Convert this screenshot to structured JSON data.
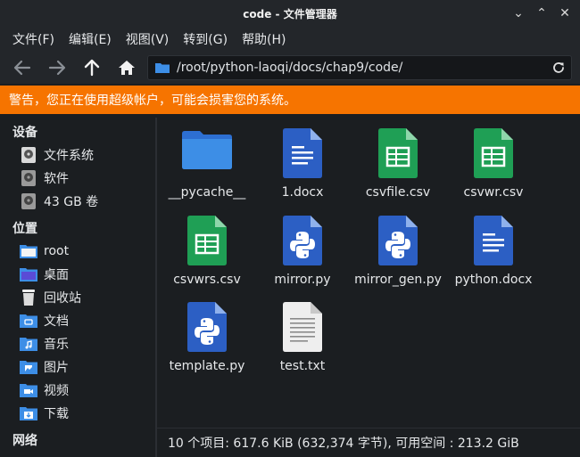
{
  "window": {
    "title": "code - 文件管理器"
  },
  "menu": [
    "文件(F)",
    "编辑(E)",
    "视图(V)",
    "转到(G)",
    "帮助(H)"
  ],
  "address": {
    "path": "/root/python-laoqi/docs/chap9/code/"
  },
  "warning": {
    "text": "警告，您正在使用超级帐户，可能会损害您的系统。",
    "color": "#f67400"
  },
  "sidebar": {
    "devices_title": "设备",
    "devices": [
      {
        "label": "文件系统",
        "icon": "drive-icon"
      },
      {
        "label": "软件",
        "icon": "drive-icon"
      },
      {
        "label": "43 GB 卷",
        "icon": "drive-icon"
      }
    ],
    "places_title": "位置",
    "places": [
      {
        "label": "root",
        "icon": "home-folder-icon"
      },
      {
        "label": "桌面",
        "icon": "desktop-folder-icon"
      },
      {
        "label": "回收站",
        "icon": "trash-icon"
      },
      {
        "label": "文档",
        "icon": "documents-folder-icon"
      },
      {
        "label": "音乐",
        "icon": "music-folder-icon"
      },
      {
        "label": "图片",
        "icon": "pictures-folder-icon"
      },
      {
        "label": "视频",
        "icon": "videos-folder-icon"
      },
      {
        "label": "下载",
        "icon": "downloads-folder-icon"
      }
    ],
    "network_title": "网络"
  },
  "files": [
    {
      "name": "__pycache__",
      "type": "folder"
    },
    {
      "name": "1.docx",
      "type": "doc"
    },
    {
      "name": "csvfile.csv",
      "type": "sheet"
    },
    {
      "name": "csvwr.csv",
      "type": "sheet"
    },
    {
      "name": "csvwrs.csv",
      "type": "sheet"
    },
    {
      "name": "mirror.py",
      "type": "python"
    },
    {
      "name": "mirror_gen.py",
      "type": "python"
    },
    {
      "name": "python.docx",
      "type": "doc"
    },
    {
      "name": "template.py",
      "type": "python"
    },
    {
      "name": "test.txt",
      "type": "text"
    }
  ],
  "status": {
    "text": "10 个项目: 617.6 KiB (632,374 字节), 可用空间 : 213.2 GiB"
  }
}
